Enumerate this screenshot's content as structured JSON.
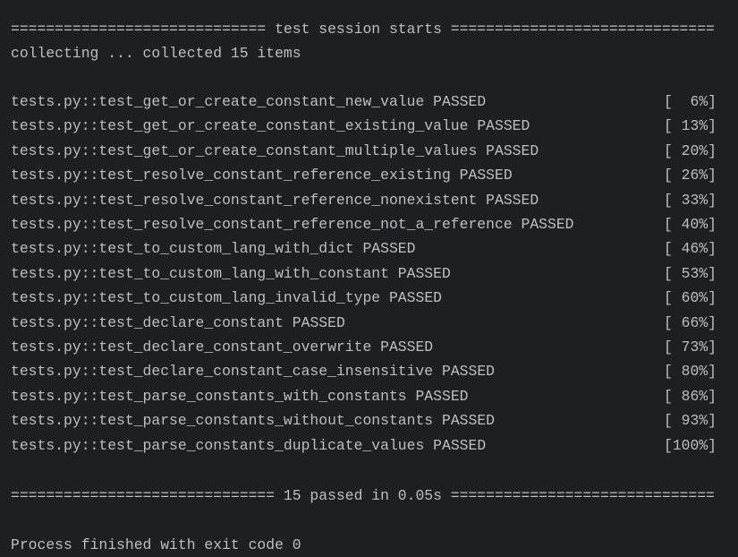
{
  "header": "============================= test session starts ==============================",
  "collecting": "collecting ... collected 15 items",
  "results": [
    {
      "name": "tests.py::test_get_or_create_constant_new_value",
      "status": "PASSED",
      "progress": "[  6%]"
    },
    {
      "name": "tests.py::test_get_or_create_constant_existing_value",
      "status": "PASSED",
      "progress": "[ 13%]"
    },
    {
      "name": "tests.py::test_get_or_create_constant_multiple_values",
      "status": "PASSED",
      "progress": "[ 20%]"
    },
    {
      "name": "tests.py::test_resolve_constant_reference_existing",
      "status": "PASSED",
      "progress": "[ 26%]"
    },
    {
      "name": "tests.py::test_resolve_constant_reference_nonexistent",
      "status": "PASSED",
      "progress": "[ 33%]"
    },
    {
      "name": "tests.py::test_resolve_constant_reference_not_a_reference",
      "status": "PASSED",
      "progress": "[ 40%]"
    },
    {
      "name": "tests.py::test_to_custom_lang_with_dict",
      "status": "PASSED",
      "progress": "[ 46%]"
    },
    {
      "name": "tests.py::test_to_custom_lang_with_constant",
      "status": "PASSED",
      "progress": "[ 53%]"
    },
    {
      "name": "tests.py::test_to_custom_lang_invalid_type",
      "status": "PASSED",
      "progress": "[ 60%]"
    },
    {
      "name": "tests.py::test_declare_constant",
      "status": "PASSED",
      "progress": "[ 66%]"
    },
    {
      "name": "tests.py::test_declare_constant_overwrite",
      "status": "PASSED",
      "progress": "[ 73%]"
    },
    {
      "name": "tests.py::test_declare_constant_case_insensitive",
      "status": "PASSED",
      "progress": "[ 80%]"
    },
    {
      "name": "tests.py::test_parse_constants_with_constants",
      "status": "PASSED",
      "progress": "[ 86%]"
    },
    {
      "name": "tests.py::test_parse_constants_without_constants",
      "status": "PASSED",
      "progress": "[ 93%]"
    },
    {
      "name": "tests.py::test_parse_constants_duplicate_values",
      "status": "PASSED",
      "progress": "[100%]"
    }
  ],
  "summary": "============================== 15 passed in 0.05s ==============================",
  "exit": "Process finished with exit code 0",
  "colors": {
    "background": "#1e1f22",
    "text": "#bcbec4"
  }
}
